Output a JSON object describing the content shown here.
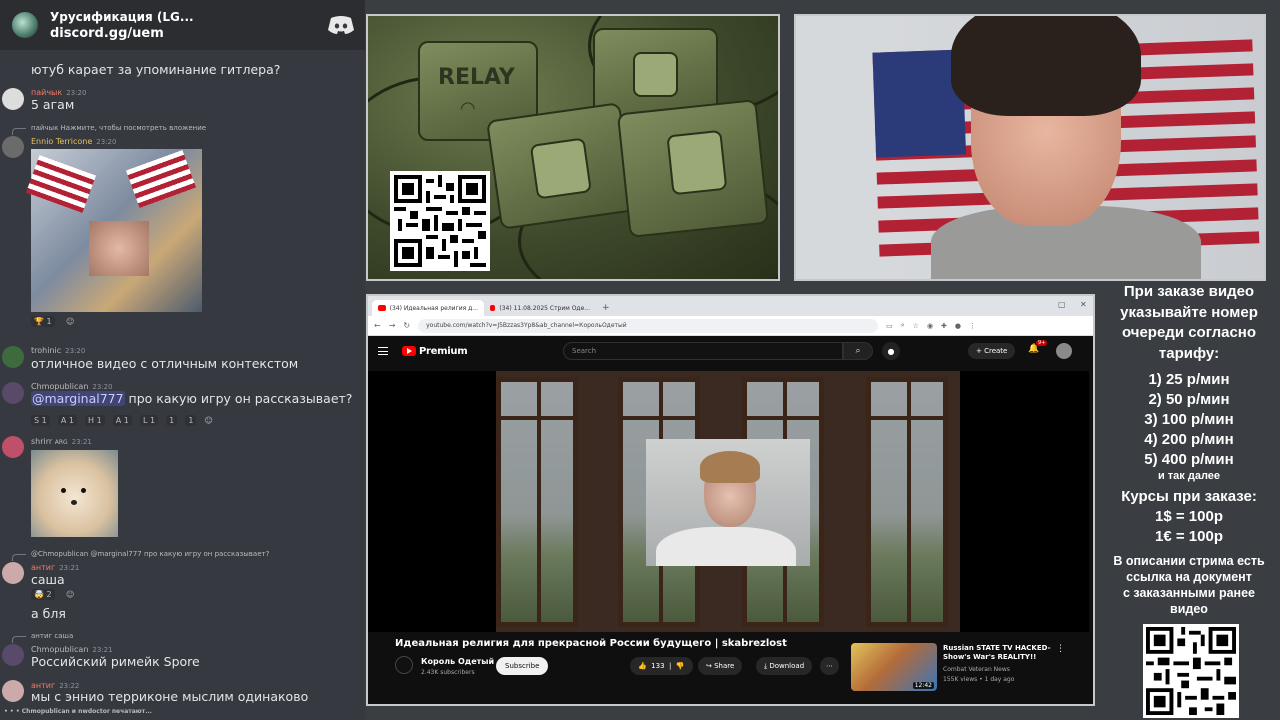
{
  "discord": {
    "server_name": "Урусификация (LG...",
    "invite": "discord.gg/uem",
    "typing_status": "Chmopublican и nwdoctor печатают..."
  },
  "messages": [
    {
      "text": "ютуб карает за упоминание гитлера?"
    },
    {
      "user": "пайчык",
      "time": "23:20",
      "text": "5 агам",
      "user_color": "#f47b67"
    },
    {
      "reply": "пайчык Нажмите, чтобы посмотреть вложение",
      "user": "Ennio Terricone",
      "time": "23:20",
      "user_color": "#e6c35c"
    },
    {
      "reaction": "1"
    },
    {
      "user": "trohinic",
      "time": "23:20",
      "text": "отличное видео с отличным контекстом",
      "user_color": "#b9bbbe"
    },
    {
      "user": "Chmopublican",
      "time": "23:20",
      "mention": "@marginal777",
      "text": " про какую игру он рассказывает?",
      "user_color": "#b9bbbe"
    },
    {
      "reactions": [
        "S 1",
        "A 1",
        "H 1",
        "A 1",
        "L 1",
        "1",
        "1"
      ]
    },
    {
      "user": "shrirr",
      "badge": "ARG",
      "time": "23:21",
      "user_color": "#b9bbbe"
    },
    {
      "reply": "@Chmopublican @marginal777 про какую игру он рассказывает?",
      "user": "антиг",
      "time": "23:21",
      "text": "саша",
      "user_color": "#f47b67"
    },
    {
      "reaction": "2"
    },
    {
      "text": "а бля"
    },
    {
      "reply": "саша",
      "user": "Chmopublican",
      "time": "23:21",
      "text": "Российский римейк Spore",
      "user_color": "#b9bbbe"
    },
    {
      "user": "антиг",
      "time": "23:22",
      "text": "мы с эннио терриконе мыслим одинаково",
      "user_color": "#f47b67"
    }
  ],
  "art": {
    "label": "RELAY"
  },
  "browser": {
    "tabs": [
      "(34) Идеальная религия д...",
      "(34) 11.08.2025 Стрим Оде..."
    ],
    "url": "youtube.com/watch?v=J5Bzzas3Yp8&ab_channel=КорольОдетый",
    "search_placeholder": "Search",
    "brand": "Premium",
    "create_label": "Create",
    "notifications": "9+",
    "video_title": "Идеальная религия для прекрасной России будущего | skabrezlost",
    "channel_name": "Король Одетый",
    "channel_subs": "2.43K subscribers",
    "subscribe_label": "Subscribe",
    "likes": "133",
    "share_label": "Share",
    "download_label": "Download",
    "recommended": {
      "title": "Russian STATE TV HACKED- Show's War's REALITY!!",
      "channel": "Combat Veteran News",
      "meta": "155K views • 1 day ago",
      "duration": "12:42"
    }
  },
  "info": {
    "heading": [
      "При заказе видео",
      "указывайте номер",
      "очереди согласно",
      "тарифу:"
    ],
    "prices": [
      "1) 25 р/мин",
      "2) 50 р/мин",
      "3) 100 р/мин",
      "4) 200 р/мин",
      "5) 400 р/мин"
    ],
    "etc": "и так далее",
    "courses_title": "Курсы при заказе:",
    "courses": [
      "1$ = 100р",
      "1€ = 100р"
    ],
    "description": [
      "В описании стрима есть",
      "ссылка на документ",
      "с заказанными ранее",
      "видео"
    ]
  },
  "colors": {
    "youtube_red": "#ff0000",
    "discord_bg": "#36393f",
    "panel_border": "#c8c8c8"
  }
}
